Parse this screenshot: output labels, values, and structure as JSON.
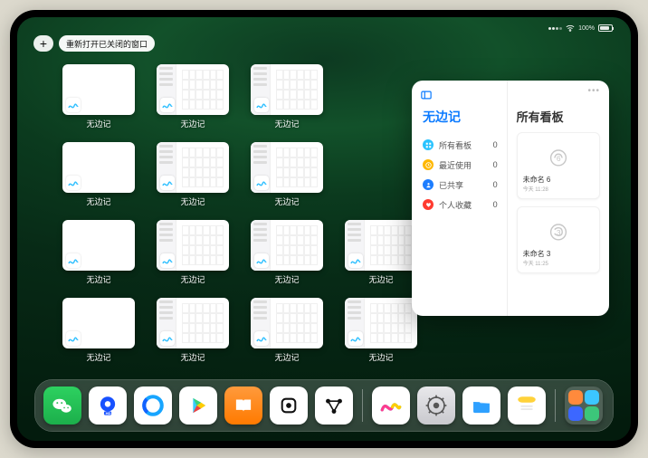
{
  "status": {
    "battery_pct": "100%"
  },
  "top": {
    "plus": "+",
    "reopen": "重新打开已关闭的窗口"
  },
  "window_label": "无边记",
  "panel": {
    "sidebar_title": "无边记",
    "right_title": "所有看板",
    "nav": [
      {
        "label": "所有看板",
        "count": "0",
        "color": "#29c3ff"
      },
      {
        "label": "最近使用",
        "count": "0",
        "color": "#ffb800"
      },
      {
        "label": "已共享",
        "count": "0",
        "color": "#1d7dff"
      },
      {
        "label": "个人收藏",
        "count": "0",
        "color": "#ff3b30"
      }
    ],
    "boards": [
      {
        "name": "未命名 6",
        "sub": "今天 11:28",
        "digit": "6"
      },
      {
        "name": "未命名 3",
        "sub": "今天 11:25",
        "digit": "3"
      }
    ]
  },
  "dock_names": [
    "wechat",
    "hd-video",
    "browser",
    "play-store",
    "books",
    "cube",
    "graph",
    "freeform",
    "settings",
    "files",
    "notes",
    "app-library"
  ]
}
